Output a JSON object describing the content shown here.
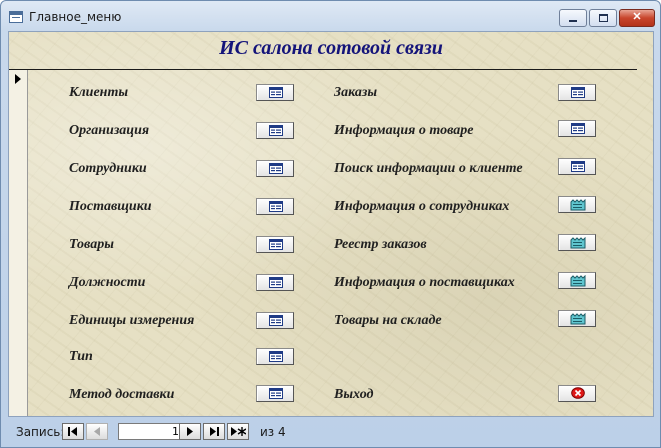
{
  "window": {
    "title": "Главное_меню"
  },
  "form": {
    "title": "ИС салона сотовой связи"
  },
  "menu": {
    "left": [
      {
        "label": "Клиенты",
        "icon": "form-icon"
      },
      {
        "label": "Организация",
        "icon": "form-icon"
      },
      {
        "label": "Сотрудники",
        "icon": "form-icon"
      },
      {
        "label": "Поставщики",
        "icon": "form-icon"
      },
      {
        "label": "Товары",
        "icon": "form-icon"
      },
      {
        "label": "Должности",
        "icon": "form-icon"
      },
      {
        "label": "Единицы измерения",
        "icon": "form-icon"
      },
      {
        "label": "Тип",
        "icon": "form-icon"
      },
      {
        "label": "Метод доставки",
        "icon": "form-icon"
      }
    ],
    "right": [
      {
        "label": "Заказы",
        "icon": "form-icon"
      },
      {
        "label": "Информация о товаре",
        "icon": "form-icon"
      },
      {
        "label": "Поиск информации о клиенте",
        "icon": "form-icon"
      },
      {
        "label": "Информация о сотрудниках",
        "icon": "report-icon"
      },
      {
        "label": "Реестр заказов",
        "icon": "report-icon"
      },
      {
        "label": "Информация о поставщиках",
        "icon": "report-icon"
      },
      {
        "label": "Товары на складе",
        "icon": "report-icon"
      },
      {
        "label": "Выход",
        "icon": "exit-icon"
      }
    ]
  },
  "navigation": {
    "record_label": "Запись:",
    "current_record": "1",
    "of_label": "из  4"
  },
  "colors": {
    "title": "#14147a",
    "background": "#e6e0c4",
    "report_icon": "#5fc5cf",
    "exit_icon": "#e01818"
  }
}
